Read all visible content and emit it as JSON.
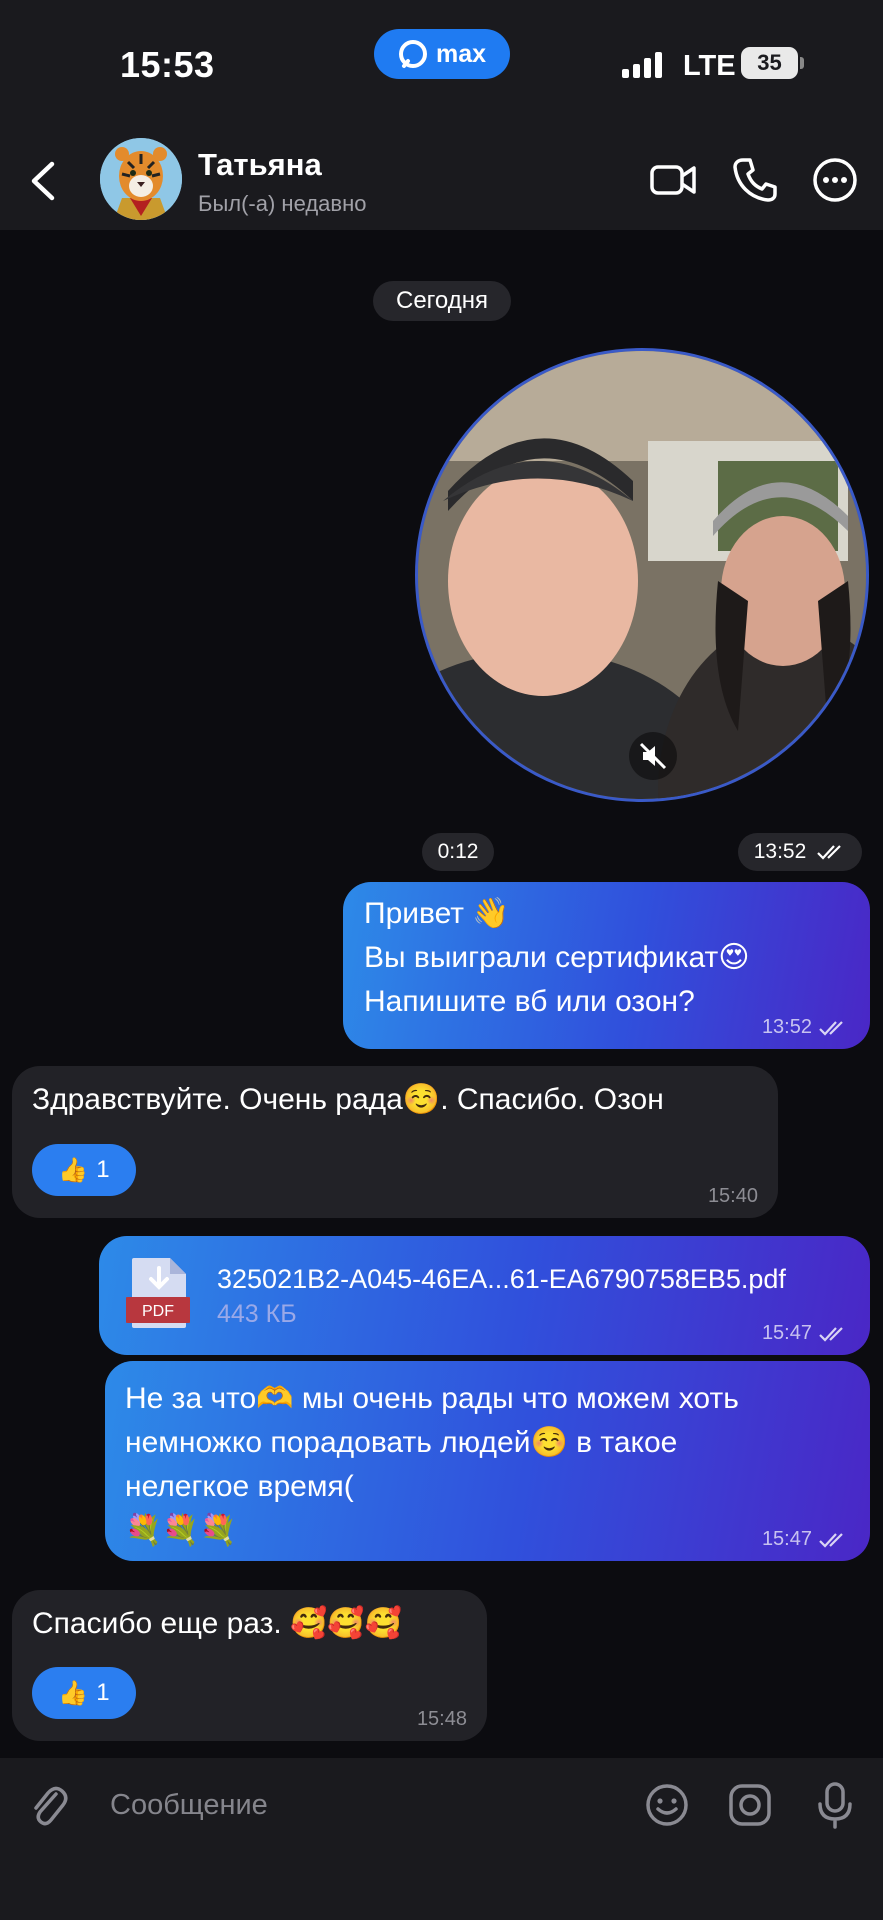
{
  "status_bar": {
    "time": "15:53",
    "app_pill": "max",
    "network": "LTE",
    "battery": "35"
  },
  "header": {
    "contact_name": "Татьяна",
    "contact_status": "Был(-а) недавно",
    "icons": [
      "back-icon",
      "video-call-icon",
      "phone-icon",
      "more-icon"
    ]
  },
  "chat": {
    "date_separator": "Сегодня",
    "video_message": {
      "duration": "0:12",
      "time": "13:52"
    },
    "messages": [
      {
        "direction": "outgoing",
        "text": "Привет 👋\nВы выиграли сертификат😍\nНапишите вб или озон?",
        "time": "13:52"
      },
      {
        "direction": "incoming",
        "text": "Здравствуйте. Очень рада☺️. Спасибо. Озон",
        "reaction": {
          "emoji": "👍",
          "count": "1"
        },
        "time": "15:40"
      },
      {
        "direction": "outgoing",
        "type": "file",
        "file_badge": "PDF",
        "file_name": "325021B2-A045-46EA...61-EA6790758EB5.pdf",
        "file_size": "443 КБ",
        "time": "15:47"
      },
      {
        "direction": "outgoing",
        "text": "Не за что🫶 мы очень рады что можем  хоть\nнемножко порадовать людей☺️ в такое\nнелегкое время(\n💐💐💐",
        "time": "15:47"
      },
      {
        "direction": "incoming",
        "text": "Спасибо еще раз. 🥰🥰🥰",
        "reaction": {
          "emoji": "👍",
          "count": "1"
        },
        "time": "15:48"
      }
    ]
  },
  "input": {
    "placeholder": "Сообщение",
    "value": ""
  },
  "colors": {
    "background": "#0c0c10",
    "bar": "#1a1a1e",
    "incoming_bubble": "#222227",
    "outgoing_gradient": [
      "#2d8ae8",
      "#3050dc",
      "#4a27c6"
    ],
    "accent": "#2b7ef0"
  }
}
